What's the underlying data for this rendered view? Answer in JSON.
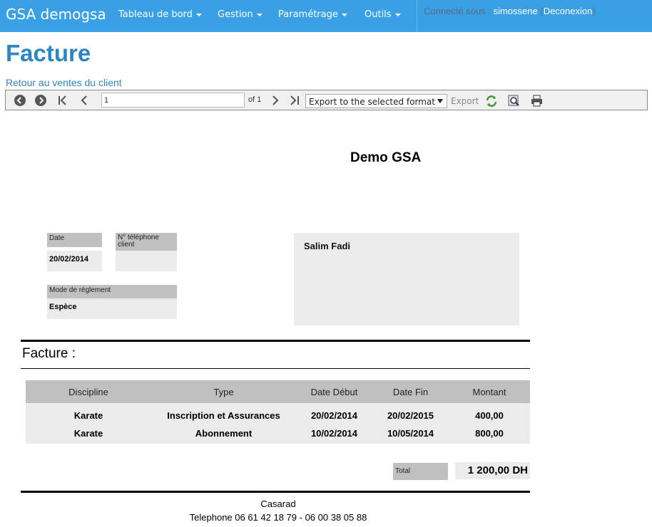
{
  "navbar": {
    "brand": "GSA demogsa",
    "menus": [
      {
        "label": "Tableau de bord"
      },
      {
        "label": "Gestion"
      },
      {
        "label": "Paramétrage"
      },
      {
        "label": "Outils"
      }
    ],
    "login_prefix": "Connecté sous :",
    "username": "simossene",
    "logout_label": "Deconexion",
    "open_paren": "(",
    "close_paren": ")"
  },
  "page": {
    "title": "Facture",
    "back_link": "Retour au ventes du client"
  },
  "toolbar": {
    "page_value": "1",
    "page_count_label": "of 1",
    "export_format_selected": "Export to the selected format",
    "export_label": "Export",
    "icons": [
      "back-icon",
      "forward-icon",
      "first-page-icon",
      "previous-page-icon",
      "next-page-icon",
      "last-page-icon",
      "refresh-icon",
      "zoom-icon",
      "print-icon"
    ]
  },
  "report": {
    "company": "Demo GSA",
    "date_label": "Date",
    "date_value": "20/02/2014",
    "phone_label": "N° téléphone client",
    "phone_value": "",
    "payment_label": "Mode de réglement",
    "payment_value": "Espèce",
    "client_name": "Salim Fadi",
    "section_title": "Facture :",
    "table": {
      "headers": [
        "Discipline",
        "Type",
        "Date Début",
        "Date Fin",
        "Montant"
      ],
      "rows": [
        [
          "Karate",
          "Inscription et Assurances",
          "20/02/2014",
          "20/02/2015",
          "400,00"
        ],
        [
          "Karate",
          "Abonnement",
          "10/02/2014",
          "10/05/2014",
          "800,00"
        ]
      ]
    },
    "total_label": "Total",
    "total_value": "1 200,00 DH",
    "footer_city": "Casarad",
    "footer_phone": "Telephone 06 61 42 18 79 - 06 00 38 05 88"
  },
  "colors": {
    "navbar_bg": "#3aa0e6",
    "title_blue": "#2d86c4",
    "label_gray": "#c0c0c0",
    "value_gray": "#ebebeb"
  }
}
